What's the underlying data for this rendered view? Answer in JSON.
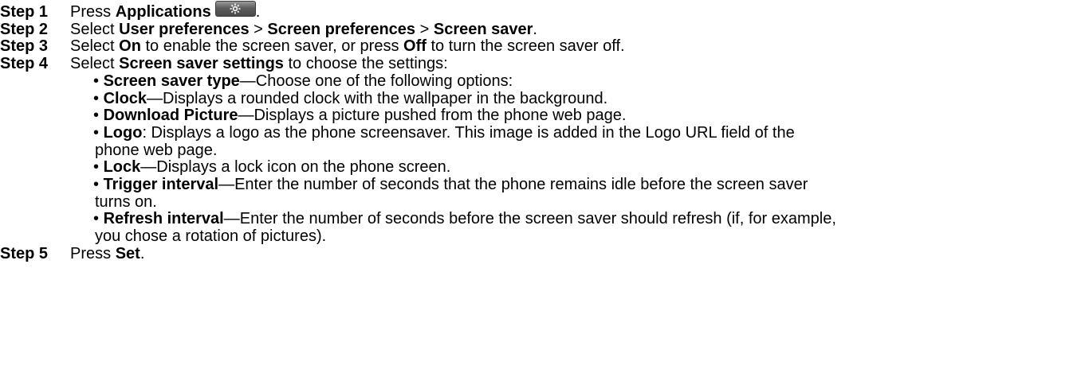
{
  "steps": [
    {
      "label": "Step 1",
      "pre": "Press ",
      "bold1": "Applications",
      "post": ".",
      "icon": "gear-icon"
    },
    {
      "label": "Step 2",
      "pre": "Select ",
      "bold1": "User preferences",
      "sep1": " > ",
      "bold2": "Screen preferences",
      "sep2": " > ",
      "bold3": "Screen saver",
      "post": "."
    },
    {
      "label": "Step 3",
      "pre": "Select ",
      "bold1": "On",
      "mid": " to enable the screen saver, or press ",
      "bold2": "Off",
      "post": " to turn the screen saver off."
    },
    {
      "label": "Step 4",
      "pre": "Select ",
      "bold1": "Screen saver settings",
      "post": " to choose the settings:"
    },
    {
      "label": "Step 5",
      "pre": "Press ",
      "bold1": "Set",
      "post": "."
    }
  ],
  "bullets": [
    {
      "mark": "• ",
      "term": "Screen saver type",
      "text": "—Choose one of the following options:"
    },
    {
      "mark": "• ",
      "term": "Clock",
      "text": "—Displays a rounded clock with the wallpaper in the background."
    },
    {
      "mark": "• ",
      "term": "Download Picture",
      "text": "—Displays a picture pushed from the phone web page."
    },
    {
      "mark": "• ",
      "term": "Logo",
      "text": ": Displays a logo as the phone screensaver. This image is added in the Logo URL field of the",
      "cont": "phone web page."
    },
    {
      "mark": "• ",
      "term": "Lock",
      "text": "—Displays a lock icon on the phone screen."
    },
    {
      "mark": "• ",
      "term": "Trigger interval",
      "text": "—Enter the number of seconds that the phone remains idle before the screen saver",
      "cont": "turns on."
    },
    {
      "mark": "• ",
      "term": "Refresh interval",
      "text": "—Enter the number of seconds before the screen saver should refresh (if, for example,",
      "cont": "you chose a rotation of pictures)."
    }
  ]
}
